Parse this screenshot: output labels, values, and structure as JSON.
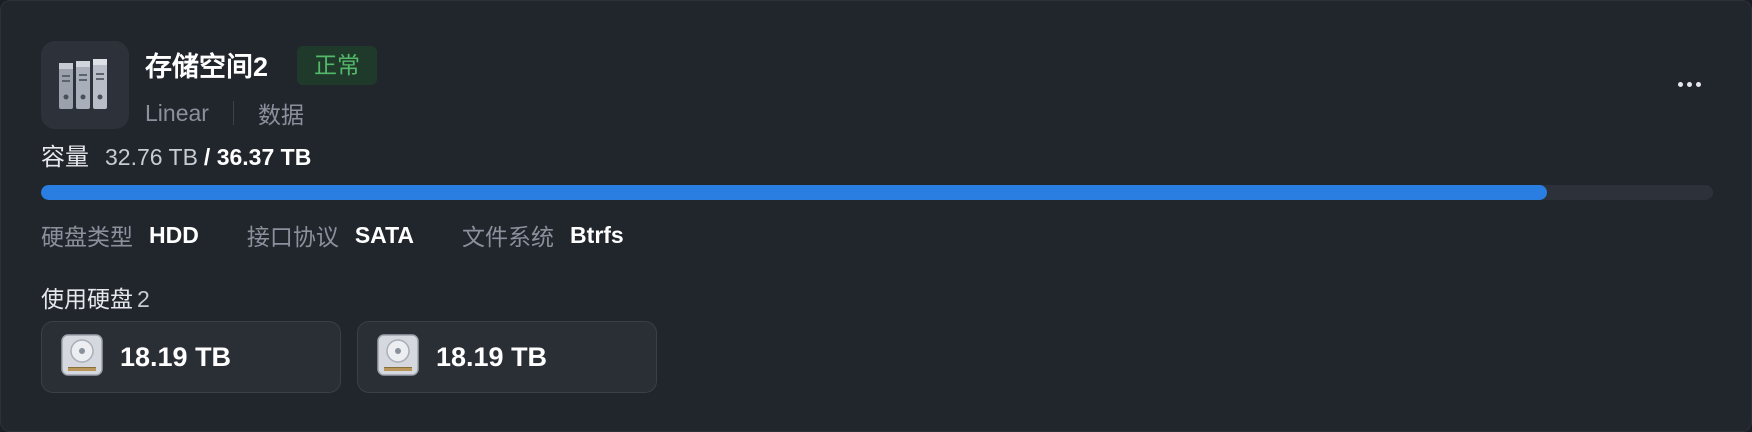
{
  "pool": {
    "icon": "storage-pool-icon",
    "name": "存储空间2",
    "status": "正常",
    "raid_type": "Linear",
    "usage_type": "数据"
  },
  "menu": {
    "icon": "more-icon"
  },
  "capacity": {
    "label": "容量",
    "used": "32.76 TB",
    "total": "/ 36.37 TB",
    "fill_fraction": 0.9007
  },
  "properties": [
    {
      "label": "硬盘类型",
      "value": "HDD"
    },
    {
      "label": "接口协议",
      "value": "SATA"
    },
    {
      "label": "文件系统",
      "value": "Btrfs"
    }
  ],
  "disks": {
    "label": "使用硬盘",
    "count": "2",
    "items": [
      {
        "icon": "hdd-icon",
        "size": "18.19 TB"
      },
      {
        "icon": "hdd-icon",
        "size": "18.19 TB"
      }
    ]
  },
  "colors": {
    "accent": "#2a7de1",
    "status_ok": "#53b86a",
    "status_ok_bg": "#1f3a2a",
    "card_bg": "#21252c"
  }
}
